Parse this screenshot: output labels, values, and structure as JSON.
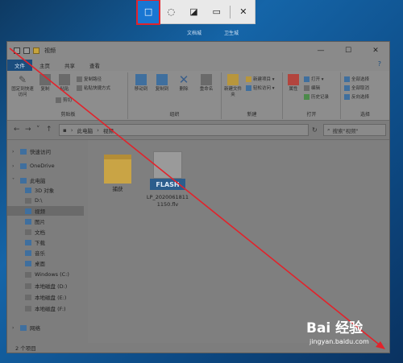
{
  "snip_toolbar": {
    "buttons": [
      {
        "name": "rectangle-snip",
        "glyph": "□"
      },
      {
        "name": "freeform-snip",
        "glyph": "◌"
      },
      {
        "name": "window-snip",
        "glyph": "◪"
      },
      {
        "name": "fullscreen-snip",
        "glyph": "▭"
      },
      {
        "name": "close",
        "glyph": "✕"
      }
    ]
  },
  "desktop_labels": [
    "文档城",
    "卫生城"
  ],
  "window": {
    "title": "视频",
    "tabs": [
      "文件",
      "主页",
      "共享",
      "查看"
    ],
    "controls": {
      "minimize": "—",
      "maximize": "☐",
      "close": "✕"
    },
    "ribbon": {
      "groups": [
        {
          "label": "剪贴板",
          "large": [
            "固定到快速访问",
            "复制",
            "粘贴"
          ],
          "small": [
            "复制路径",
            "粘贴快捷方式",
            "剪切"
          ]
        },
        {
          "label": "组织",
          "large": [
            "移动到",
            "复制到",
            "删除",
            "重命名"
          ]
        },
        {
          "label": "新建",
          "large": [
            "新建文件夹"
          ],
          "small": [
            "新建项目 ▾",
            "轻松访问 ▾"
          ]
        },
        {
          "label": "打开",
          "large": [
            "属性"
          ],
          "small": [
            "打开 ▾",
            "编辑",
            "历史记录"
          ]
        },
        {
          "label": "选择",
          "small": [
            "全部选择",
            "全部取消",
            "反向选择"
          ]
        }
      ]
    },
    "address": {
      "nav": {
        "back": "←",
        "forward": "→",
        "recent": "˅",
        "up": "↑"
      },
      "path": [
        "此电脑",
        "视频"
      ],
      "search_placeholder": "搜索\"视频\""
    },
    "nav_pane": {
      "items": [
        {
          "label": "快速访问",
          "level": 0
        },
        {
          "label": "OneDrive",
          "level": 0
        },
        {
          "label": "此电脑",
          "level": 0
        },
        {
          "label": "3D 对象",
          "level": 1
        },
        {
          "label": "D:\\",
          "level": 1
        },
        {
          "label": "视频",
          "level": 1,
          "selected": true
        },
        {
          "label": "图片",
          "level": 1
        },
        {
          "label": "文档",
          "level": 1
        },
        {
          "label": "下载",
          "level": 1
        },
        {
          "label": "音乐",
          "level": 1
        },
        {
          "label": "桌面",
          "level": 1
        },
        {
          "label": "Windows (C:)",
          "level": 1
        },
        {
          "label": "本地磁盘 (D:)",
          "level": 1
        },
        {
          "label": "本地磁盘 (E:)",
          "level": 1
        },
        {
          "label": "本地磁盘 (F:)",
          "level": 1
        },
        {
          "label": "网络",
          "level": 0
        }
      ]
    },
    "files": [
      {
        "name": "捕获",
        "type": "folder"
      },
      {
        "name": "LP_20200618111150.flv",
        "type": "flash",
        "line1": "LP_2020061811",
        "line2": "1150.flv",
        "badge": "FLASH"
      }
    ],
    "status": "2 个项目"
  },
  "watermark": {
    "main": "Bai 经验",
    "sub": "jingyan.baidu.com"
  },
  "colors": {
    "accent": "#1976d2",
    "snip_highlight": "#e3222a",
    "arrow": "#e3222a"
  }
}
